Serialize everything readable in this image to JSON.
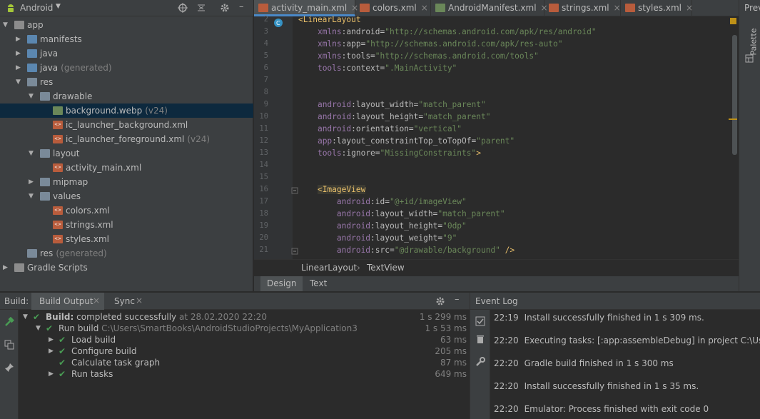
{
  "project": {
    "view_label": "Android",
    "items": [
      {
        "label": "app",
        "extra": ""
      },
      {
        "label": "manifests",
        "extra": ""
      },
      {
        "label": "java",
        "extra": ""
      },
      {
        "label": "java",
        "extra": "(generated)"
      },
      {
        "label": "res",
        "extra": ""
      },
      {
        "label": "drawable",
        "extra": ""
      },
      {
        "label": "background.webp",
        "extra": "(v24)"
      },
      {
        "label": "ic_launcher_background.xml",
        "extra": ""
      },
      {
        "label": "ic_launcher_foreground.xml",
        "extra": "(v24)"
      },
      {
        "label": "layout",
        "extra": ""
      },
      {
        "label": "activity_main.xml",
        "extra": ""
      },
      {
        "label": "mipmap",
        "extra": ""
      },
      {
        "label": "values",
        "extra": ""
      },
      {
        "label": "colors.xml",
        "extra": ""
      },
      {
        "label": "strings.xml",
        "extra": ""
      },
      {
        "label": "styles.xml",
        "extra": ""
      },
      {
        "label": "res",
        "extra": "(generated)"
      },
      {
        "label": "Gradle Scripts",
        "extra": ""
      }
    ]
  },
  "tabs": [
    {
      "label": "activity_main.xml",
      "icon": "xml-icon"
    },
    {
      "label": "colors.xml",
      "icon": "xml-icon"
    },
    {
      "label": "AndroidManifest.xml",
      "icon": "manifest-icon"
    },
    {
      "label": "strings.xml",
      "icon": "xml-icon"
    },
    {
      "label": "styles.xml",
      "icon": "xml-icon"
    }
  ],
  "right_strip": {
    "top_label": "Prev",
    "palette": "Palette"
  },
  "editor": {
    "line_numbers": [
      "2",
      "3",
      "4",
      "5",
      "6",
      "7",
      "8",
      "9",
      "10",
      "11",
      "12",
      "13",
      "14",
      "15",
      "16",
      "17",
      "18",
      "19",
      "20",
      "21"
    ],
    "lines": [
      {
        "indent": "",
        "parts": [
          [
            "tag",
            "<LinearLayout"
          ]
        ]
      },
      {
        "indent": "    ",
        "parts": [
          [
            "ns",
            "xmlns"
          ],
          [
            "attr",
            ":android="
          ],
          [
            "str",
            "\"http://schemas.android.com/apk/res/android\""
          ]
        ]
      },
      {
        "indent": "    ",
        "parts": [
          [
            "ns",
            "xmlns"
          ],
          [
            "attr",
            ":app="
          ],
          [
            "str",
            "\"http://schemas.android.com/apk/res-auto\""
          ]
        ]
      },
      {
        "indent": "    ",
        "parts": [
          [
            "ns",
            "xmlns"
          ],
          [
            "attr",
            ":tools="
          ],
          [
            "str",
            "\"http://schemas.android.com/tools\""
          ]
        ]
      },
      {
        "indent": "    ",
        "parts": [
          [
            "ns",
            "tools"
          ],
          [
            "attr",
            ":context="
          ],
          [
            "str",
            "\".MainActivity\""
          ]
        ]
      },
      {
        "indent": "",
        "parts": []
      },
      {
        "indent": "",
        "parts": []
      },
      {
        "indent": "    ",
        "parts": [
          [
            "ns",
            "android"
          ],
          [
            "attr",
            ":layout_width="
          ],
          [
            "str",
            "\"match_parent\""
          ]
        ]
      },
      {
        "indent": "    ",
        "parts": [
          [
            "ns",
            "android"
          ],
          [
            "attr",
            ":layout_height="
          ],
          [
            "str",
            "\"match_parent\""
          ]
        ]
      },
      {
        "indent": "    ",
        "parts": [
          [
            "ns",
            "android"
          ],
          [
            "attr",
            ":orientation="
          ],
          [
            "str",
            "\"vertical\""
          ]
        ]
      },
      {
        "indent": "    ",
        "parts": [
          [
            "ns",
            "app"
          ],
          [
            "attr",
            ":layout_constraintTop_toTopOf="
          ],
          [
            "str",
            "\"parent\""
          ]
        ]
      },
      {
        "indent": "    ",
        "parts": [
          [
            "ns",
            "tools"
          ],
          [
            "attr",
            ":ignore="
          ],
          [
            "str",
            "\"MissingConstraints\""
          ],
          [
            "tag",
            ">"
          ]
        ]
      },
      {
        "indent": "",
        "parts": []
      },
      {
        "indent": "",
        "parts": []
      },
      {
        "indent": "    ",
        "parts": [
          [
            "tag",
            "<ImageView"
          ]
        ]
      },
      {
        "indent": "        ",
        "parts": [
          [
            "ns",
            "android"
          ],
          [
            "attr",
            ":id="
          ],
          [
            "str",
            "\"@+id/imageView\""
          ]
        ]
      },
      {
        "indent": "        ",
        "parts": [
          [
            "ns",
            "android"
          ],
          [
            "attr",
            ":layout_width="
          ],
          [
            "str",
            "\"match_parent\""
          ]
        ]
      },
      {
        "indent": "        ",
        "parts": [
          [
            "ns",
            "android"
          ],
          [
            "attr",
            ":layout_height="
          ],
          [
            "str",
            "\"0dp\""
          ]
        ]
      },
      {
        "indent": "        ",
        "parts": [
          [
            "ns",
            "android"
          ],
          [
            "attr",
            ":layout_weight="
          ],
          [
            "str",
            "\"9\""
          ]
        ]
      },
      {
        "indent": "        ",
        "parts": [
          [
            "ns",
            "android"
          ],
          [
            "attr",
            ":src="
          ],
          [
            "str",
            "\"@drawable/background\""
          ],
          [
            "tag",
            " />"
          ]
        ]
      }
    ]
  },
  "breadcrumb": {
    "first": "LinearLayout",
    "second": "TextView"
  },
  "design_tabs": {
    "design": "Design",
    "text": "Text"
  },
  "build": {
    "label": "Build:",
    "tab_output": "Build Output",
    "tab_sync": "Sync",
    "rows": [
      {
        "bold": "Build:",
        "text": " completed successfully",
        "dim": " at 28.02.2020 22:20",
        "time": "1 s 299 ms"
      },
      {
        "bold": "",
        "text": "Run build",
        "dim": " C:\\Users\\SmartBooks\\AndroidStudioProjects\\MyApplication3",
        "time": "1 s 53 ms"
      },
      {
        "bold": "",
        "text": "Load build",
        "dim": "",
        "time": "63 ms"
      },
      {
        "bold": "",
        "text": "Configure build",
        "dim": "",
        "time": "205 ms"
      },
      {
        "bold": "",
        "text": "Calculate task graph",
        "dim": "",
        "time": "87 ms"
      },
      {
        "bold": "",
        "text": "Run tasks",
        "dim": "",
        "time": "649 ms"
      }
    ]
  },
  "event_log": {
    "title": "Event Log",
    "entries": [
      {
        "time": "22:19",
        "text": "Install successfully finished in 1 s 309 ms."
      },
      {
        "time": "22:20",
        "text": "Executing tasks: [:app:assembleDebug] in project C:\\Users\\SmartB"
      },
      {
        "time": "22:20",
        "text": "Gradle build finished in 1 s 300 ms"
      },
      {
        "time": "22:20",
        "text": "Install successfully finished in 1 s 35 ms."
      },
      {
        "time": "22:20",
        "text": "Emulator: Process finished with exit code 0"
      }
    ]
  },
  "colors": {
    "accent": "#4a88c7",
    "success": "#499c54",
    "android_green": "#a4c639"
  }
}
